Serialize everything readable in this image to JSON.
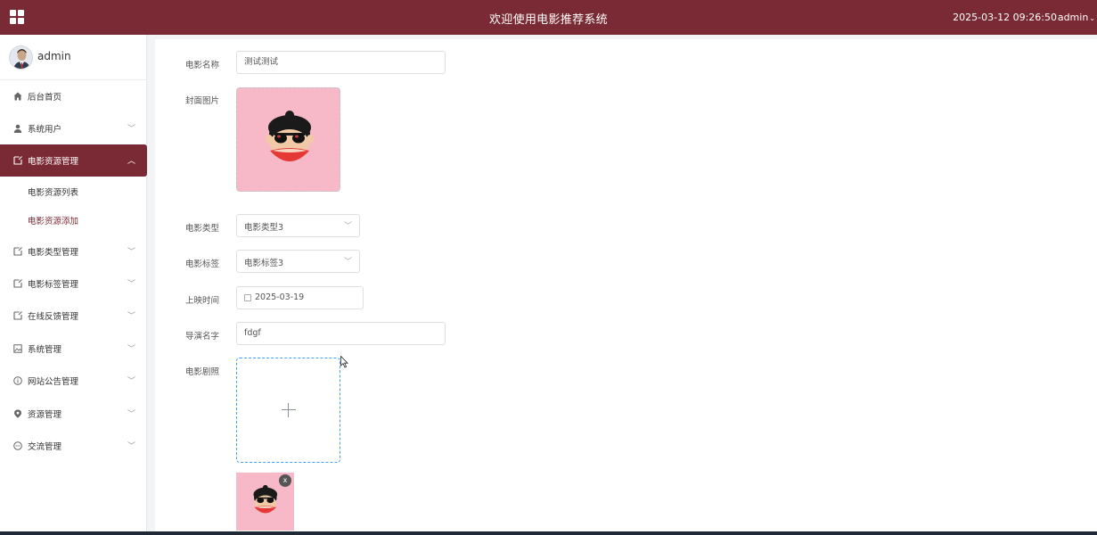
{
  "header": {
    "title": "欢迎使用电影推荐系统",
    "datetime": "2025-03-12 09:26:50",
    "user": "admin",
    "brand_color": "#7a2a34"
  },
  "sidebar": {
    "user_name": "admin",
    "items": [
      {
        "label": "后台首页",
        "icon": "home-icon",
        "has_arrow": false
      },
      {
        "label": "系统用户",
        "icon": "user-icon",
        "has_arrow": true
      },
      {
        "label": "电影资源管理",
        "icon": "document-icon",
        "has_arrow": true,
        "active": true,
        "children": [
          {
            "label": "电影资源列表"
          },
          {
            "label": "电影资源添加",
            "current": true
          }
        ]
      },
      {
        "label": "电影类型管理",
        "icon": "document-icon",
        "has_arrow": true
      },
      {
        "label": "电影标签管理",
        "icon": "document-icon",
        "has_arrow": true
      },
      {
        "label": "在线反馈管理",
        "icon": "document-icon",
        "has_arrow": true
      },
      {
        "label": "系统管理",
        "icon": "image-icon",
        "has_arrow": true
      },
      {
        "label": "网站公告管理",
        "icon": "info-icon",
        "has_arrow": true
      },
      {
        "label": "资源管理",
        "icon": "location-icon",
        "has_arrow": true
      },
      {
        "label": "交流管理",
        "icon": "chat-icon",
        "has_arrow": true
      }
    ]
  },
  "form": {
    "name_label": "电影名称",
    "name_value": "测试测试",
    "cover_label": "封面图片",
    "type_label": "电影类型",
    "type_value": "电影类型3",
    "tag_label": "电影标签",
    "tag_value": "电影标签3",
    "date_label": "上映时间",
    "date_value": "2025-03-19",
    "director_label": "导演名字",
    "director_value": "fdgf",
    "stills_label": "电影剧照",
    "remove_label": "x"
  }
}
